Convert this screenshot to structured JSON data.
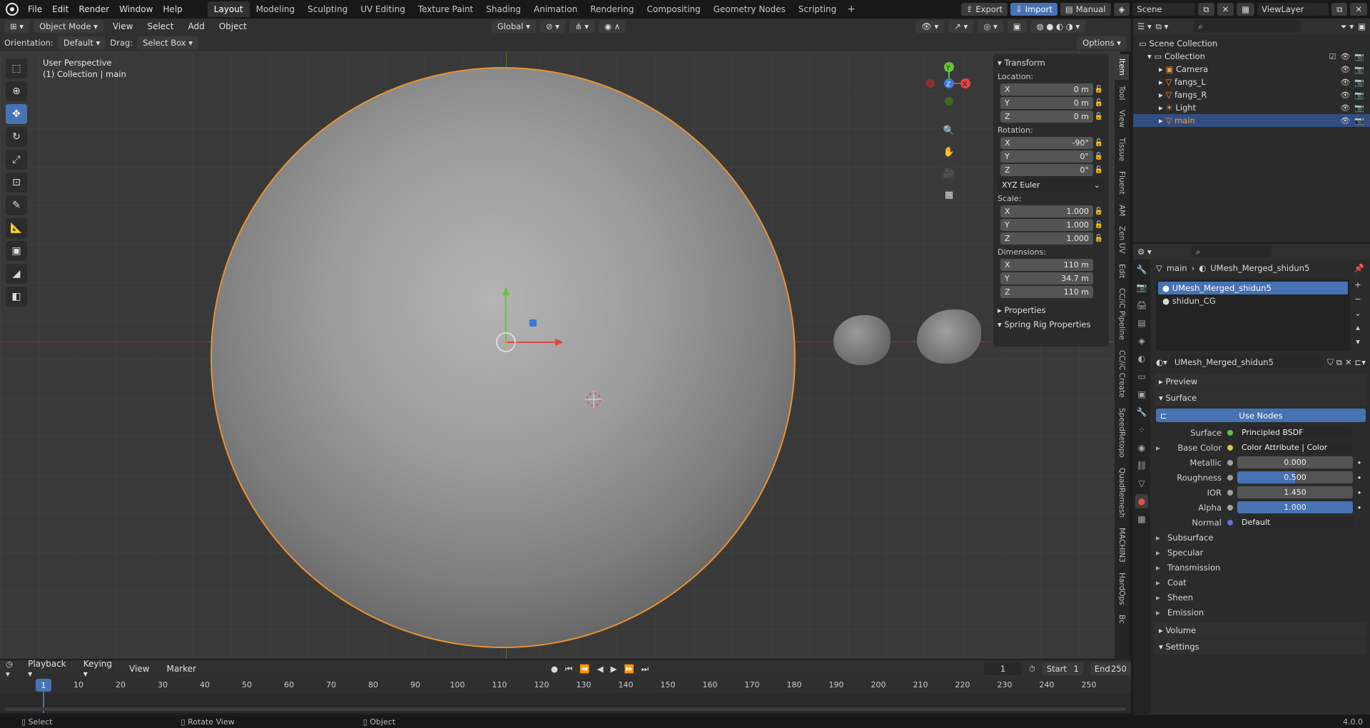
{
  "menu": {
    "items": [
      "File",
      "Edit",
      "Render",
      "Window",
      "Help"
    ]
  },
  "workspaces": [
    "Layout",
    "Modeling",
    "Sculpting",
    "UV Editing",
    "Texture Paint",
    "Shading",
    "Animation",
    "Rendering",
    "Compositing",
    "Geometry Nodes",
    "Scripting"
  ],
  "active_workspace": "Layout",
  "top_right": {
    "export": "Export",
    "import": "Import",
    "manual": "Manual",
    "scene": "Scene",
    "view_layer": "ViewLayer"
  },
  "header": {
    "mode": "Object Mode",
    "view": "View",
    "select": "Select",
    "add": "Add",
    "object": "Object",
    "transform_orientation": "Global"
  },
  "header3": {
    "orientation_label": "Orientation:",
    "orientation": "Default",
    "drag_label": "Drag:",
    "drag": "Select Box",
    "options": "Options"
  },
  "viewport": {
    "perspective": "User Perspective",
    "collection": "(1) Collection | main"
  },
  "npanel": {
    "transform": "Transform",
    "location_label": "Location:",
    "location": [
      {
        "axis": "X",
        "value": "0 m"
      },
      {
        "axis": "Y",
        "value": "0 m"
      },
      {
        "axis": "Z",
        "value": "0 m"
      }
    ],
    "rotation_label": "Rotation:",
    "rotation": [
      {
        "axis": "X",
        "value": "-90°"
      },
      {
        "axis": "Y",
        "value": "0°"
      },
      {
        "axis": "Z",
        "value": "0°"
      }
    ],
    "rotation_mode": "XYZ Euler",
    "scale_label": "Scale:",
    "scale": [
      {
        "axis": "X",
        "value": "1.000"
      },
      {
        "axis": "Y",
        "value": "1.000"
      },
      {
        "axis": "Z",
        "value": "1.000"
      }
    ],
    "dimensions_label": "Dimensions:",
    "dimensions": [
      {
        "axis": "X",
        "value": "110 m"
      },
      {
        "axis": "Y",
        "value": "34.7 m"
      },
      {
        "axis": "Z",
        "value": "110 m"
      }
    ],
    "properties": "Properties",
    "spring_rig": "Spring Rig Properties"
  },
  "side_tabs": [
    "Item",
    "Tool",
    "View",
    "Tissue",
    "Fluent",
    "AM",
    "Zen UV",
    "Edit",
    "CC/iC Pipeline",
    "CC/iC Create",
    "SpeedRetopo",
    "QuadRemesh",
    "MACHIN3",
    "HardOps",
    "Bc"
  ],
  "outliner": {
    "scene_collection": "Scene Collection",
    "collection": "Collection",
    "items": [
      "Camera",
      "fangs_L",
      "fangs_R",
      "Light",
      "main"
    ]
  },
  "properties": {
    "breadcrumb_object": "main",
    "breadcrumb_mesh": "UMesh_Merged_shidun5",
    "material_slots": [
      "UMesh_Merged_shidun5",
      "shidun_CG"
    ],
    "material_name": "UMesh_Merged_shidun5",
    "preview": "Preview",
    "surface_section": "Surface",
    "use_nodes": "Use Nodes",
    "surface_label": "Surface",
    "surface_value": "Principled BSDF",
    "base_color_label": "Base Color",
    "base_color_value": "Color Attribute | Color",
    "metallic_label": "Metallic",
    "metallic": "0.000",
    "roughness_label": "Roughness",
    "roughness": "0.500",
    "ior_label": "IOR",
    "ior": "1.450",
    "alpha_label": "Alpha",
    "alpha": "1.000",
    "normal_label": "Normal",
    "normal": "Default",
    "subsections": [
      "Subsurface",
      "Specular",
      "Transmission",
      "Coat",
      "Sheen",
      "Emission"
    ],
    "volume": "Volume",
    "settings": "Settings"
  },
  "timeline": {
    "playback": "Playback",
    "keying": "Keying",
    "view": "View",
    "marker": "Marker",
    "current_frame": "1",
    "start_label": "Start",
    "start": "1",
    "end_label": "End",
    "end": "250",
    "ticks": [
      "10",
      "20",
      "30",
      "40",
      "50",
      "60",
      "70",
      "80",
      "90",
      "100",
      "110",
      "120",
      "130",
      "140",
      "150",
      "160",
      "170",
      "180",
      "190",
      "200",
      "210",
      "220",
      "230",
      "240",
      "250"
    ],
    "cursor": "1"
  },
  "status": {
    "select": "Select",
    "rotate": "Rotate View",
    "object": "Object",
    "version": "4.0.0"
  },
  "colors": {
    "accent": "#4772b3",
    "selection_outline": "#e8912f",
    "panel": "#2b2b2b"
  }
}
